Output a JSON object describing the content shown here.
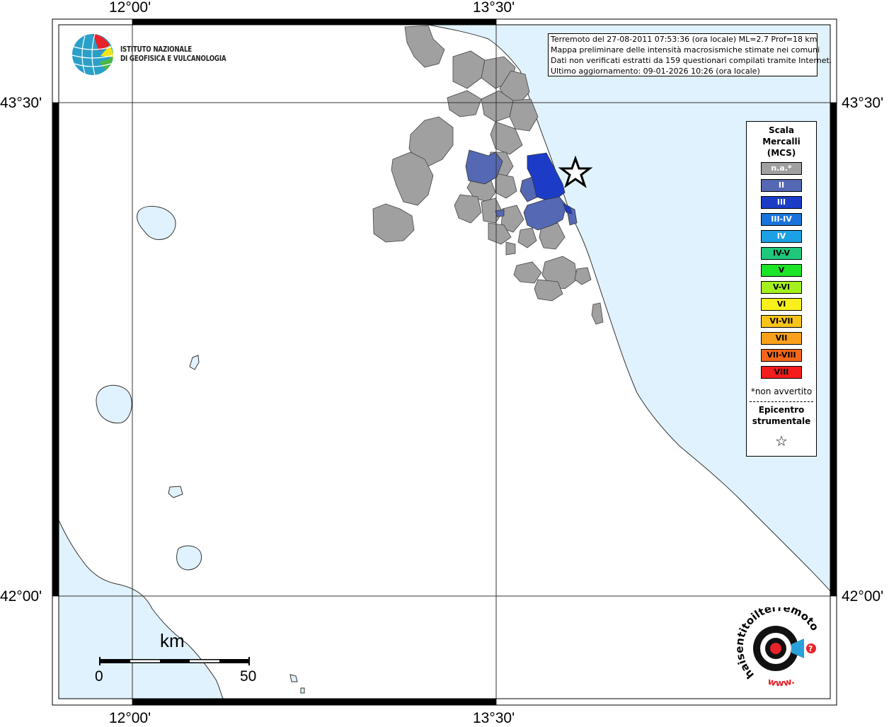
{
  "info": {
    "line1": "Terremoto del 27-08-2011 07:53:36 (ora locale) ML=2.7 Prof=18 km",
    "line2": "Mappa preliminare delle intensità macrosismiche stimate nei comuni",
    "line3": "Dati non verificati estratti da 159 questionari compilati tramite Internet.",
    "line4": "Ultimo aggiornamento: 09-01-2026 10:26 (ora locale)"
  },
  "ingv": {
    "line1": "ISTITUTO NAZIONALE",
    "line2": "DI GEOFISICA E VULCANOLOGIA"
  },
  "axes": {
    "lon_left": "12°00'",
    "lon_right": "13°30'",
    "lat_top": "43°30'",
    "lat_bottom": "42°00'"
  },
  "legend": {
    "title1": "Scala",
    "title2": "Mercalli",
    "title3": "(MCS)",
    "items": [
      {
        "label": "n.a.*",
        "color": "#a0a0a0"
      },
      {
        "label": "II",
        "color": "#5468b4"
      },
      {
        "label": "III",
        "color": "#1c3cc8"
      },
      {
        "label": "III-IV",
        "color": "#1874dc"
      },
      {
        "label": "IV",
        "color": "#1ca0e6"
      },
      {
        "label": "IV-V",
        "color": "#20c87c"
      },
      {
        "label": "V",
        "color": "#1ee428"
      },
      {
        "label": "V-VI",
        "color": "#a4f01c"
      },
      {
        "label": "VI",
        "color": "#f8f01a"
      },
      {
        "label": "VI-VII",
        "color": "#f8c41a"
      },
      {
        "label": "VII",
        "color": "#f8a01a"
      },
      {
        "label": "VII-VIII",
        "color": "#f66618"
      },
      {
        "label": "VIII",
        "color": "#f41c1c"
      }
    ],
    "note": "*non avvertito",
    "epi1": "Epicentro",
    "epi2": "strumentale",
    "star": "☆"
  },
  "scale": {
    "unit": "km",
    "min": "0",
    "max": "50"
  },
  "haisentito": {
    "top": "haisentitoilterremoto.it",
    "bottom": "www."
  },
  "colors": {
    "sea": "#e0f2fd",
    "na": "#a0a0a0",
    "ii": "#5468b4",
    "iii": "#1c3cc8"
  }
}
